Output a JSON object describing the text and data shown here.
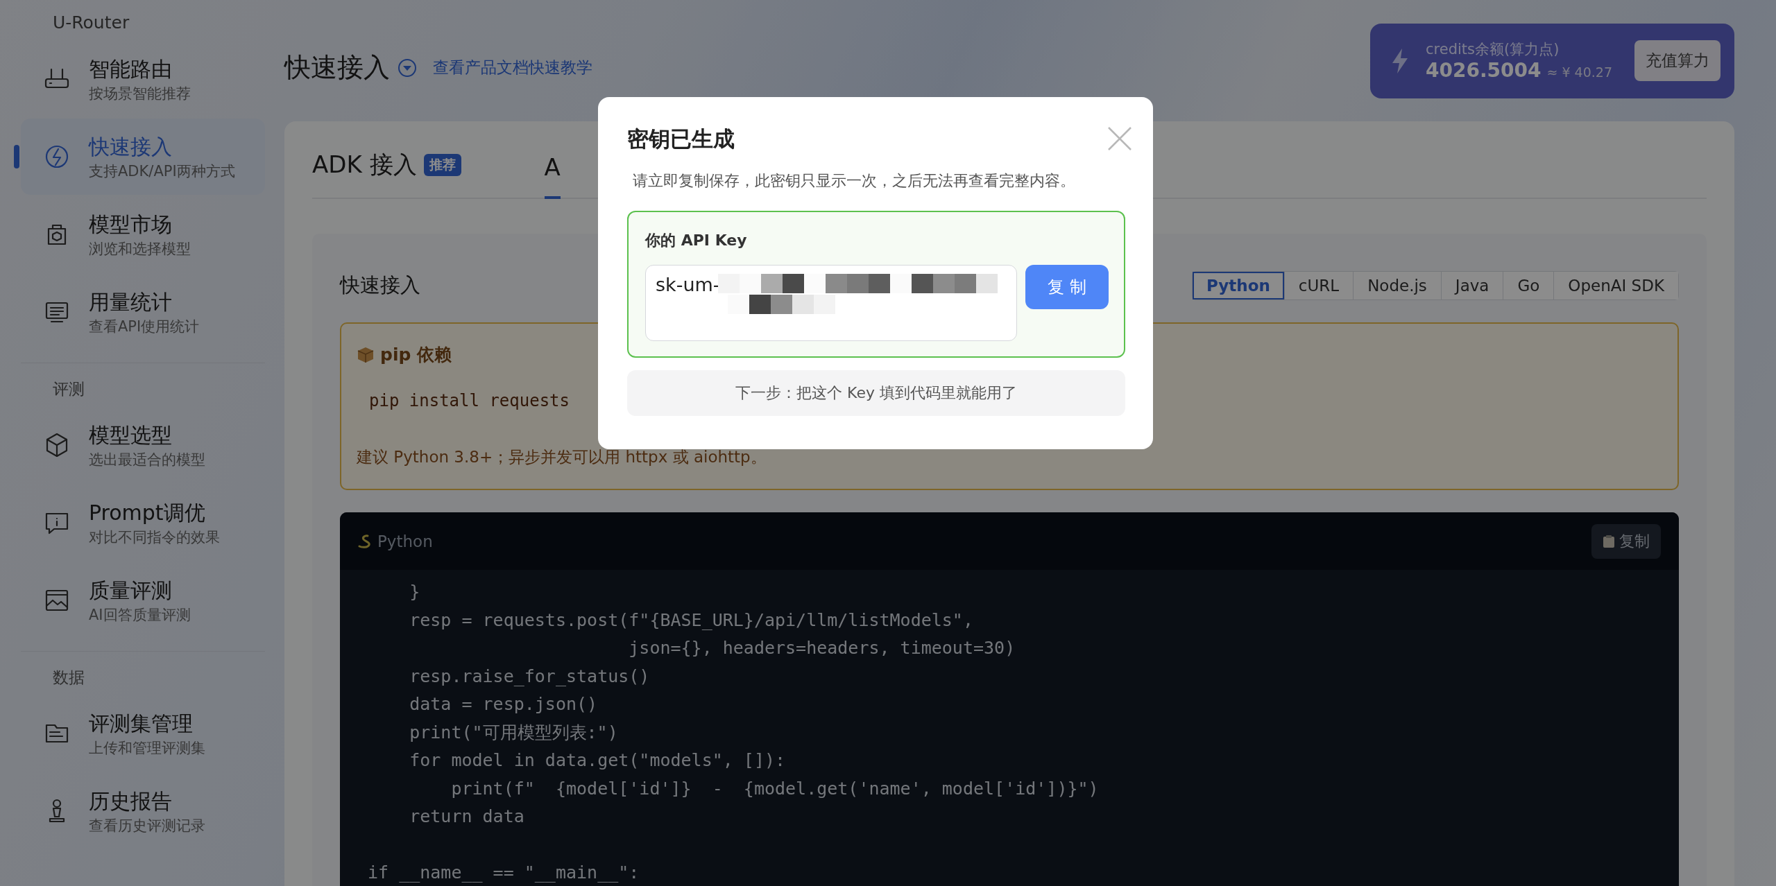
{
  "sidebar": {
    "brand": "U-Router",
    "sections": [
      {
        "items": [
          {
            "title": "智能路由",
            "subtitle": "按场景智能推荐",
            "selected": false
          },
          {
            "title": "快速接入",
            "subtitle": "支持ADK/API两种方式",
            "selected": true
          },
          {
            "title": "模型市场",
            "subtitle": "浏览和选择模型",
            "selected": false
          },
          {
            "title": "用量统计",
            "subtitle": "查看API使用统计",
            "selected": false
          }
        ]
      },
      {
        "label": "评测",
        "items": [
          {
            "title": "模型选型",
            "subtitle": "选出最适合的模型",
            "selected": false
          },
          {
            "title": "Prompt调优",
            "subtitle": "对比不同指令的效果",
            "selected": false
          },
          {
            "title": "质量评测",
            "subtitle": "AI回答质量评测",
            "selected": false
          }
        ]
      },
      {
        "label": "数据",
        "items": [
          {
            "title": "评测集管理",
            "subtitle": "上传和管理评测集",
            "selected": false
          },
          {
            "title": "历史报告",
            "subtitle": "查看历史评测记录",
            "selected": false
          }
        ]
      }
    ]
  },
  "header": {
    "title": "快速接入",
    "doc_link": "查看产品文档快速教学"
  },
  "credits": {
    "label": "credits余额(算力点)",
    "amount": "4026.5004",
    "approx": "≈ ¥ 40.27",
    "button": "充值算力"
  },
  "tabs": [
    {
      "label": "ADK 接入",
      "badge": "推荐",
      "selected": false
    },
    {
      "label": "A",
      "selected": true
    }
  ],
  "quickstart": {
    "title": "快速接入",
    "languages": [
      {
        "label": "Python",
        "selected": true
      },
      {
        "label": "cURL",
        "selected": false
      },
      {
        "label": "Node.js",
        "selected": false
      },
      {
        "label": "Java",
        "selected": false
      },
      {
        "label": "Go",
        "selected": false
      },
      {
        "label": "OpenAI SDK",
        "selected": false
      }
    ],
    "pip": {
      "title": "pip 依赖",
      "command": "pip install requests",
      "note": "建议 Python 3.8+；异步并发可以用 httpx 或 aiohttp。"
    },
    "code": {
      "language": "Python",
      "copy": "复制",
      "text": "    }\n    resp = requests.post(f\"{BASE_URL}/api/llm/listModels\",\n                         json={}, headers=headers, timeout=30)\n    resp.raise_for_status()\n    data = resp.json()\n    print(\"可用模型列表:\")\n    for model in data.get(\"models\", []):\n        print(f\"  {model['id']}  -  {model.get('name', model['id'])}\")\n    return data\n\nif __name__ == \"__main__\":"
    }
  },
  "modal": {
    "title": "密钥已生成",
    "description": "请立即复制保存，此密钥只显示一次，之后无法再查看完整内容。",
    "key_label": "你的 API Key",
    "key_value": "sk-um-",
    "copy": "复 制",
    "next_step": "下一步：把这个 Key 填到代码里就能用了"
  }
}
